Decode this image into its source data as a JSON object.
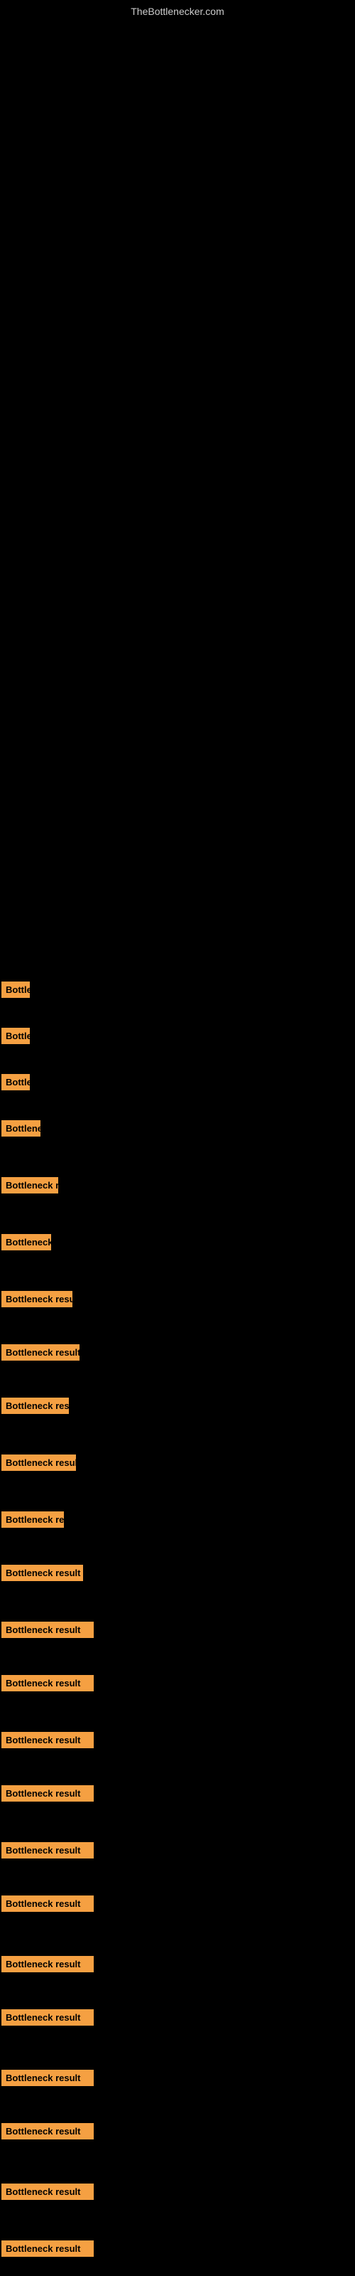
{
  "site": {
    "title": "TheBottlenecker.com"
  },
  "items": [
    {
      "id": 1,
      "label": "Bottleneck result",
      "width_class": "w-tiny"
    },
    {
      "id": 2,
      "label": "Bottleneck result",
      "width_class": "w-small1"
    },
    {
      "id": 3,
      "label": "Bottleneck result",
      "width_class": "w-small2"
    },
    {
      "id": 4,
      "label": "Bottleneck result",
      "width_class": "w-med1"
    },
    {
      "id": 5,
      "label": "Bottleneck result",
      "width_class": "w-med2"
    },
    {
      "id": 6,
      "label": "Bottleneck result",
      "width_class": "w-med3"
    },
    {
      "id": 7,
      "label": "Bottleneck result",
      "width_class": "w-med4"
    },
    {
      "id": 8,
      "label": "Bottleneck result",
      "width_class": "w-med5"
    },
    {
      "id": 9,
      "label": "Bottleneck result",
      "width_class": "w-med6"
    },
    {
      "id": 10,
      "label": "Bottleneck result",
      "width_class": "w-med7"
    },
    {
      "id": 11,
      "label": "Bottleneck result",
      "width_class": "w-med8"
    },
    {
      "id": 12,
      "label": "Bottleneck result",
      "width_class": "w-med9"
    },
    {
      "id": 13,
      "label": "Bottleneck result",
      "width_class": "w-full"
    },
    {
      "id": 14,
      "label": "Bottleneck result",
      "width_class": "w-full"
    },
    {
      "id": 15,
      "label": "Bottleneck result",
      "width_class": "w-full"
    },
    {
      "id": 16,
      "label": "Bottleneck result",
      "width_class": "w-full"
    },
    {
      "id": 17,
      "label": "Bottleneck result",
      "width_class": "w-full"
    },
    {
      "id": 18,
      "label": "Bottleneck result",
      "width_class": "w-full"
    },
    {
      "id": 19,
      "label": "Bottleneck result",
      "width_class": "w-full"
    },
    {
      "id": 20,
      "label": "Bottleneck result",
      "width_class": "w-full"
    },
    {
      "id": 21,
      "label": "Bottleneck result",
      "width_class": "w-full"
    },
    {
      "id": 22,
      "label": "Bottleneck result",
      "width_class": "w-full"
    },
    {
      "id": 23,
      "label": "Bottleneck result",
      "width_class": "w-full"
    },
    {
      "id": 24,
      "label": "Bottleneck result",
      "width_class": "w-full"
    }
  ]
}
